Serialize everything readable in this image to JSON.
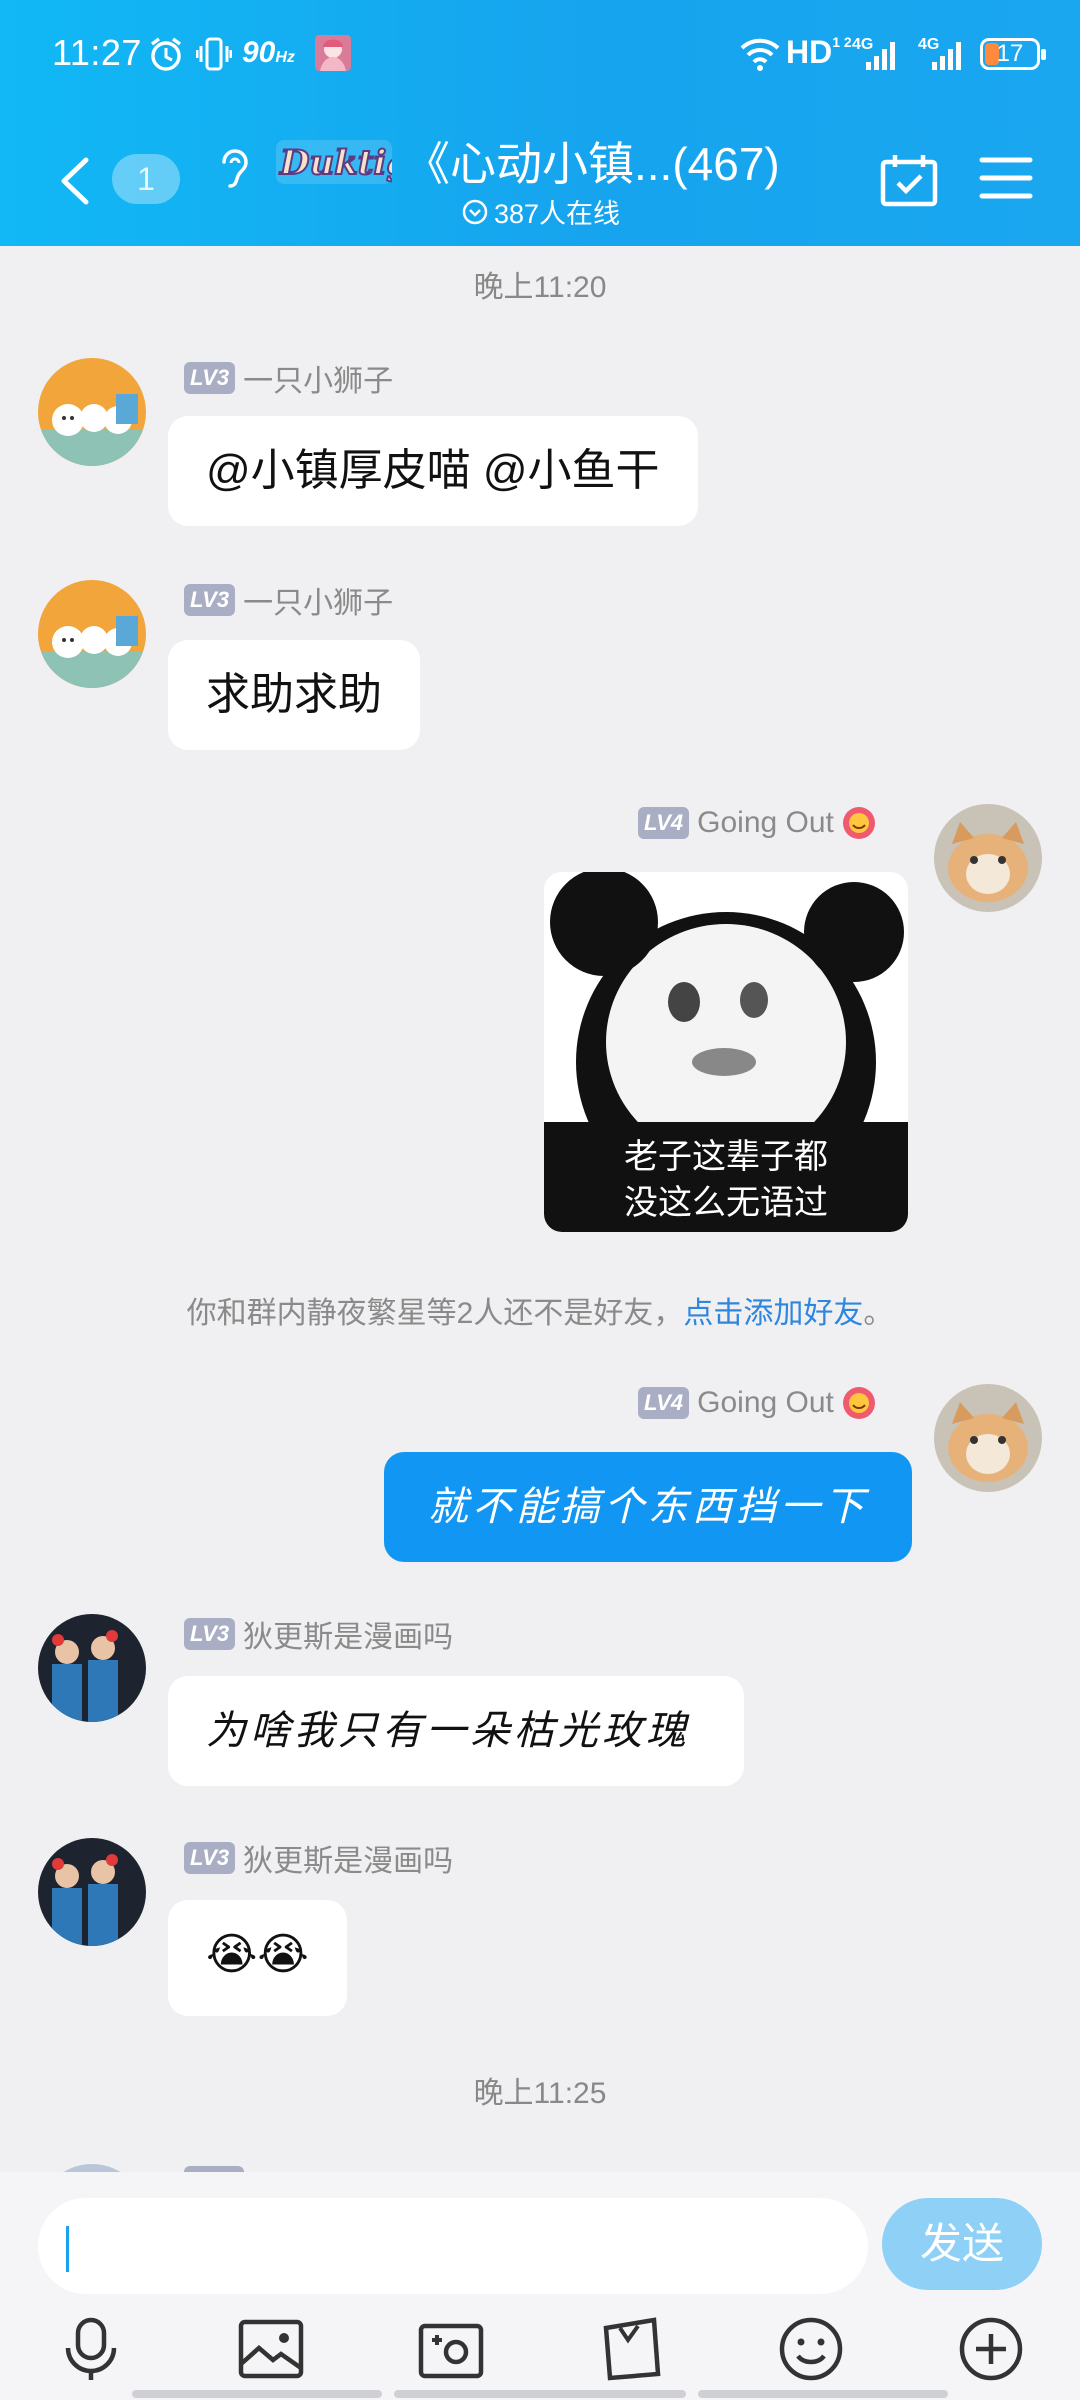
{
  "status": {
    "time": "11:27",
    "refresh": "90",
    "refresh_unit": "Hz",
    "hd": "HD",
    "net1": "4G",
    "net2": "4G",
    "battery": "17"
  },
  "header": {
    "unread": "1",
    "title": "《心动小镇...(467)",
    "online": "387人在线",
    "logo_text": "Duktig."
  },
  "colors": {
    "accent": "#16a4ee",
    "my_bubble": "#1296f3",
    "link": "#2e86de"
  },
  "messages": [
    {
      "time": "晚上11:20"
    },
    {
      "level": "LV3",
      "sender": "一只小狮子",
      "text": "@小镇厚皮喵 @小鱼干"
    },
    {
      "level": "LV3",
      "sender": "一只小狮子",
      "text": "求助求助"
    },
    {
      "level": "LV4",
      "sender": "Going Out",
      "sticker_caption_1": "老子这辈子都",
      "sticker_caption_2": "没这么无语过"
    },
    {
      "notice": "你和群内静夜繁星等2人还不是好友，",
      "notice_link": "点击添加好友",
      "notice_end": "。"
    },
    {
      "level": "LV4",
      "sender": "Going Out",
      "text": "就不能搞个东西挡一下"
    },
    {
      "level": "LV3",
      "sender": "狄更斯是漫画吗",
      "text": "为啥我只有一朵枯光玫瑰"
    },
    {
      "level": "LV3",
      "sender": "狄更斯是漫画吗",
      "text": "😭😭"
    },
    {
      "time": "晚上11:25"
    }
  ],
  "input": {
    "placeholder": "",
    "send_label": "发送"
  },
  "toolbar": [
    "microphone-icon",
    "image-icon",
    "camera-icon",
    "file-icon",
    "emoji-icon",
    "plus-icon"
  ]
}
